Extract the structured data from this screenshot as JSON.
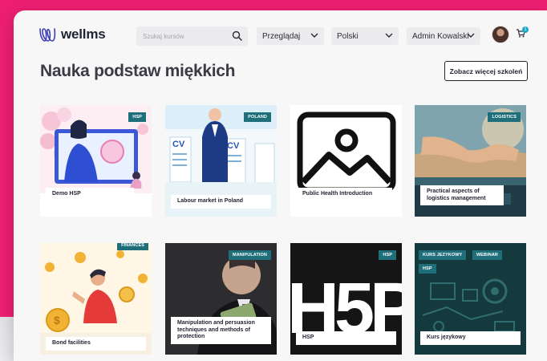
{
  "header": {
    "logo_text": "wellms",
    "search_placeholder": "Szukaj kursów",
    "browse_label": "Przeglądaj",
    "language_label": "Polski",
    "user_label": "Admin Kowalski",
    "cart_count": "1"
  },
  "section": {
    "title": "Nauka podstaw miękkich",
    "more_button": "Zobacz więcej szkoleń"
  },
  "courses": [
    {
      "title": "Demo HSP",
      "tags": [
        "HSP"
      ]
    },
    {
      "title": "Labour market in Poland",
      "tags": [
        "POLAND"
      ]
    },
    {
      "title": "Public Health Introduction",
      "tags": []
    },
    {
      "title": "Practical aspects of logistics management",
      "tags": [
        "LOGISTICS"
      ]
    },
    {
      "title": "Bond facilities",
      "tags": [
        "FINANCES"
      ]
    },
    {
      "title": "Manipulation and persuasion techniques and methods of protection",
      "tags": [
        "MANIPULATION"
      ]
    },
    {
      "title": "HSP",
      "tags": [
        "HSP"
      ]
    },
    {
      "title": "Kurs językowy",
      "tags": [
        "KURS JEZYKOWY",
        "WEBINAR",
        "HSP"
      ]
    }
  ],
  "colors": {
    "background_accent": "#ee1f73",
    "tag": "#1f6f7a",
    "logo": "#3b3fb5"
  }
}
